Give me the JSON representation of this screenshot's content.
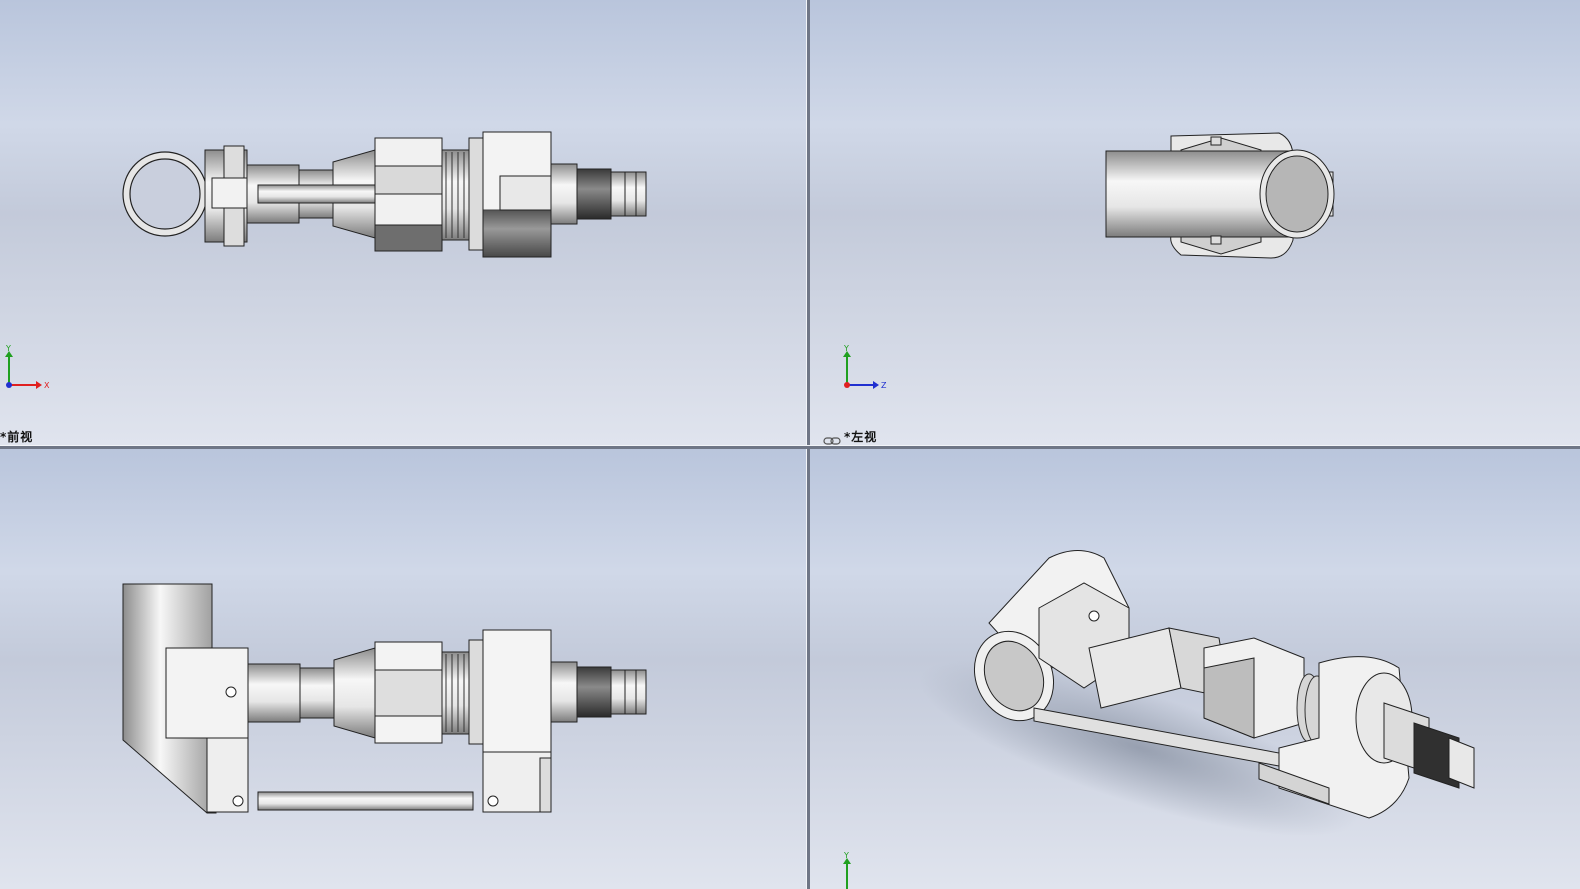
{
  "app": {
    "colors": {
      "background_top": "#b9c5dc",
      "background_bottom": "#e0e4ee",
      "divider": "#6f7686",
      "axis_x": "#e02020",
      "axis_y": "#20a020",
      "axis_z": "#2030d0"
    }
  },
  "viewports": {
    "front": {
      "label": "*前视",
      "triad": {
        "h_axis": "X",
        "v_axis": "Y"
      }
    },
    "left": {
      "label": "*左视",
      "link_icon": "chain-link-icon",
      "triad": {
        "h_axis": "Z",
        "v_axis": "Y"
      }
    },
    "top": {
      "label": ""
    },
    "iso": {
      "label": "",
      "triad": {
        "v_axis": "Y"
      }
    }
  }
}
